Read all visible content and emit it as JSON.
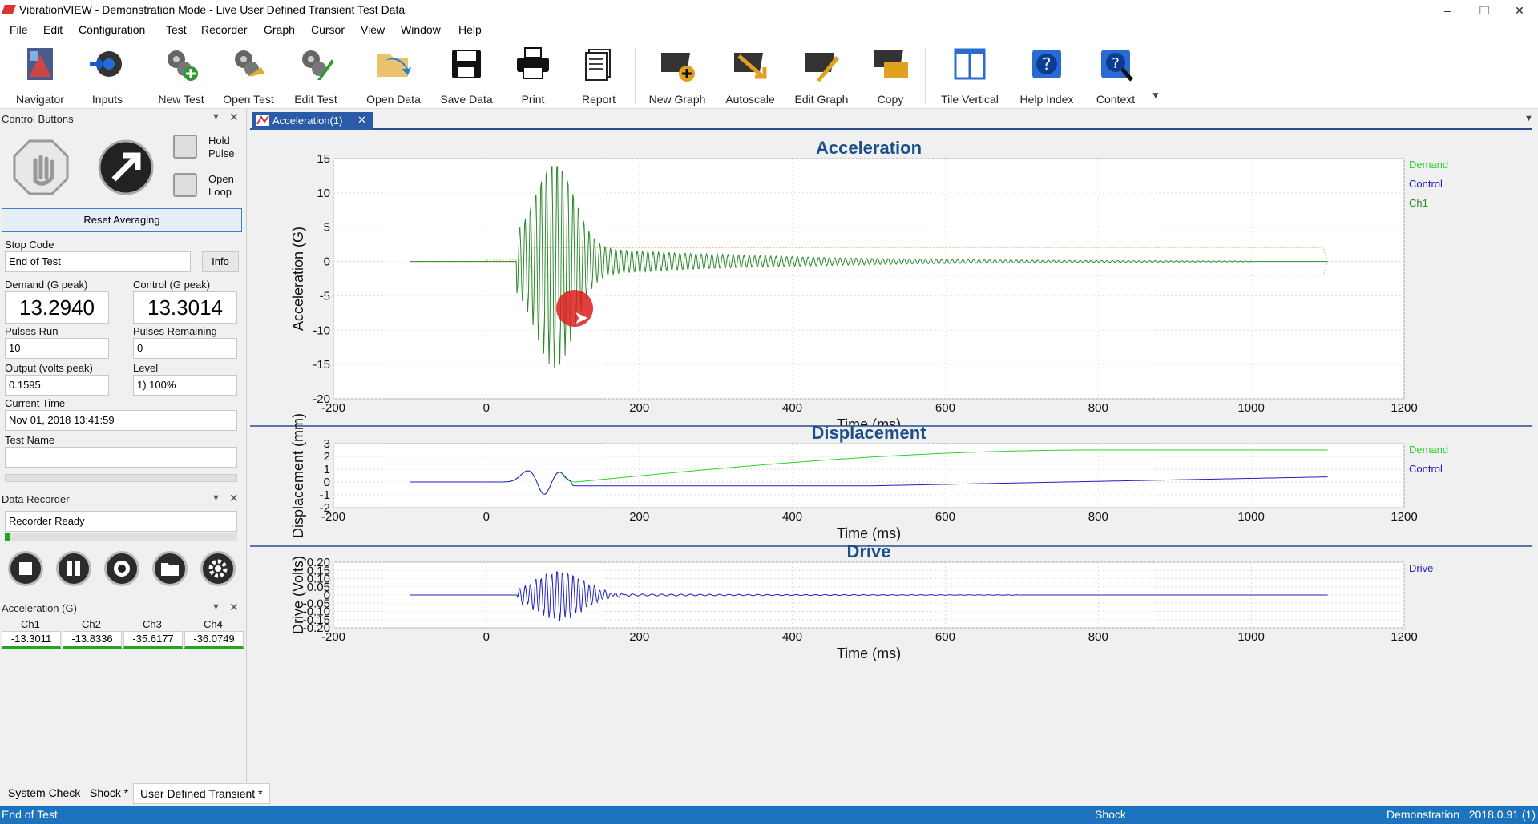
{
  "window": {
    "title": "VibrationVIEW - Demonstration Mode - Live User Defined Transient Test Data",
    "minimize": "–",
    "restore": "❐",
    "close": "✕"
  },
  "menu": [
    "File",
    "Edit",
    "Configuration",
    "Test",
    "Recorder",
    "Graph",
    "Cursor",
    "View",
    "Window",
    "Help"
  ],
  "toolbar": [
    {
      "label": "Navigator",
      "icon": "navigator-icon"
    },
    {
      "label": "Inputs",
      "icon": "inputs-icon"
    },
    {
      "label": "New Test",
      "icon": "new-test-icon"
    },
    {
      "label": "Open Test",
      "icon": "open-test-icon"
    },
    {
      "label": "Edit Test",
      "icon": "edit-test-icon"
    },
    {
      "label": "Open Data",
      "icon": "open-data-icon"
    },
    {
      "label": "Save Data",
      "icon": "save-data-icon"
    },
    {
      "label": "Print",
      "icon": "print-icon"
    },
    {
      "label": "Report",
      "icon": "report-icon"
    },
    {
      "label": "New Graph",
      "icon": "new-graph-icon"
    },
    {
      "label": "Autoscale",
      "icon": "autoscale-icon"
    },
    {
      "label": "Edit Graph",
      "icon": "edit-graph-icon"
    },
    {
      "label": "Copy",
      "icon": "copy-icon"
    },
    {
      "label": "Tile Vertical",
      "icon": "tile-vertical-icon"
    },
    {
      "label": "Help Index",
      "icon": "help-index-icon"
    },
    {
      "label": "Context",
      "icon": "context-help-icon"
    }
  ],
  "control": {
    "title": "Control Buttons",
    "hold_pulse": "Hold\nPulse",
    "open_loop": "Open\nLoop",
    "reset": "Reset Averaging",
    "stop_code_label": "Stop Code",
    "stop_code": "End of Test",
    "info": "Info",
    "demand_label": "Demand (G peak)",
    "demand": "13.2940",
    "control_label": "Control (G peak)",
    "control": "13.3014",
    "pulses_run_label": "Pulses Run",
    "pulses_run": "10",
    "pulses_remaining_label": "Pulses Remaining",
    "pulses_remaining": "0",
    "output_label": "Output (volts peak)",
    "output": "0.1595",
    "level_label": "Level",
    "level": "1) 100%",
    "current_time_label": "Current Time",
    "current_time": "Nov 01, 2018 13:41:59",
    "test_name_label": "Test Name",
    "test_name": ""
  },
  "recorder": {
    "title": "Data Recorder",
    "status": "Recorder Ready",
    "progress": 0.02
  },
  "accel_table": {
    "title": "Acceleration (G)",
    "headers": [
      "Ch1",
      "Ch2",
      "Ch3",
      "Ch4"
    ],
    "values": [
      "-13.3011",
      "-13.8336",
      "-35.6177",
      "-36.0749"
    ]
  },
  "tab": "Acceleration(1)",
  "chart_data": [
    {
      "type": "line",
      "title": "Acceleration",
      "xlabel": "Time (ms)",
      "ylabel": "Acceleration (G)",
      "xlim": [
        -200,
        1200
      ],
      "ylim": [
        -20,
        15
      ],
      "xticks": [
        -200,
        0,
        200,
        400,
        600,
        800,
        1000,
        1200
      ],
      "yticks": [
        15,
        10,
        5,
        0,
        -5,
        -10,
        -15,
        -20
      ],
      "series": [
        {
          "name": "Demand",
          "color": "#2bd12b"
        },
        {
          "name": "Control",
          "color": "#2020c0"
        },
        {
          "name": "Ch1",
          "color": "#2a8a2a"
        }
      ]
    },
    {
      "type": "line",
      "title": "Displacement",
      "xlabel": "Time (ms)",
      "ylabel": "Displacement (mm)",
      "xlim": [
        -200,
        1200
      ],
      "ylim": [
        -2,
        3
      ],
      "xticks": [
        -200,
        0,
        200,
        400,
        600,
        800,
        1000,
        1200
      ],
      "yticks": [
        3,
        2,
        1,
        0,
        -1,
        -2
      ],
      "series": [
        {
          "name": "Demand",
          "color": "#2bd12b"
        },
        {
          "name": "Control",
          "color": "#2020c0"
        }
      ]
    },
    {
      "type": "line",
      "title": "Drive",
      "xlabel": "Time (ms)",
      "ylabel": "Drive (Volts)",
      "xlim": [
        -200,
        1200
      ],
      "ylim": [
        -0.2,
        0.2
      ],
      "xticks": [
        -200,
        0,
        200,
        400,
        600,
        800,
        1000,
        1200
      ],
      "yticks": [
        "0.20",
        "0.15",
        "0.10",
        "0.05",
        "0",
        "-0.05",
        "-0.10",
        "-0.15",
        "-0.20"
      ],
      "series": [
        {
          "name": "Drive",
          "color": "#2020c0"
        }
      ]
    }
  ],
  "bottom_tabs": [
    "System Check",
    "Shock *",
    "User Defined Transient *"
  ],
  "status": {
    "left": "End of Test",
    "mid": "Shock",
    "right": "Demonstration   2018.0.91 (1)"
  }
}
